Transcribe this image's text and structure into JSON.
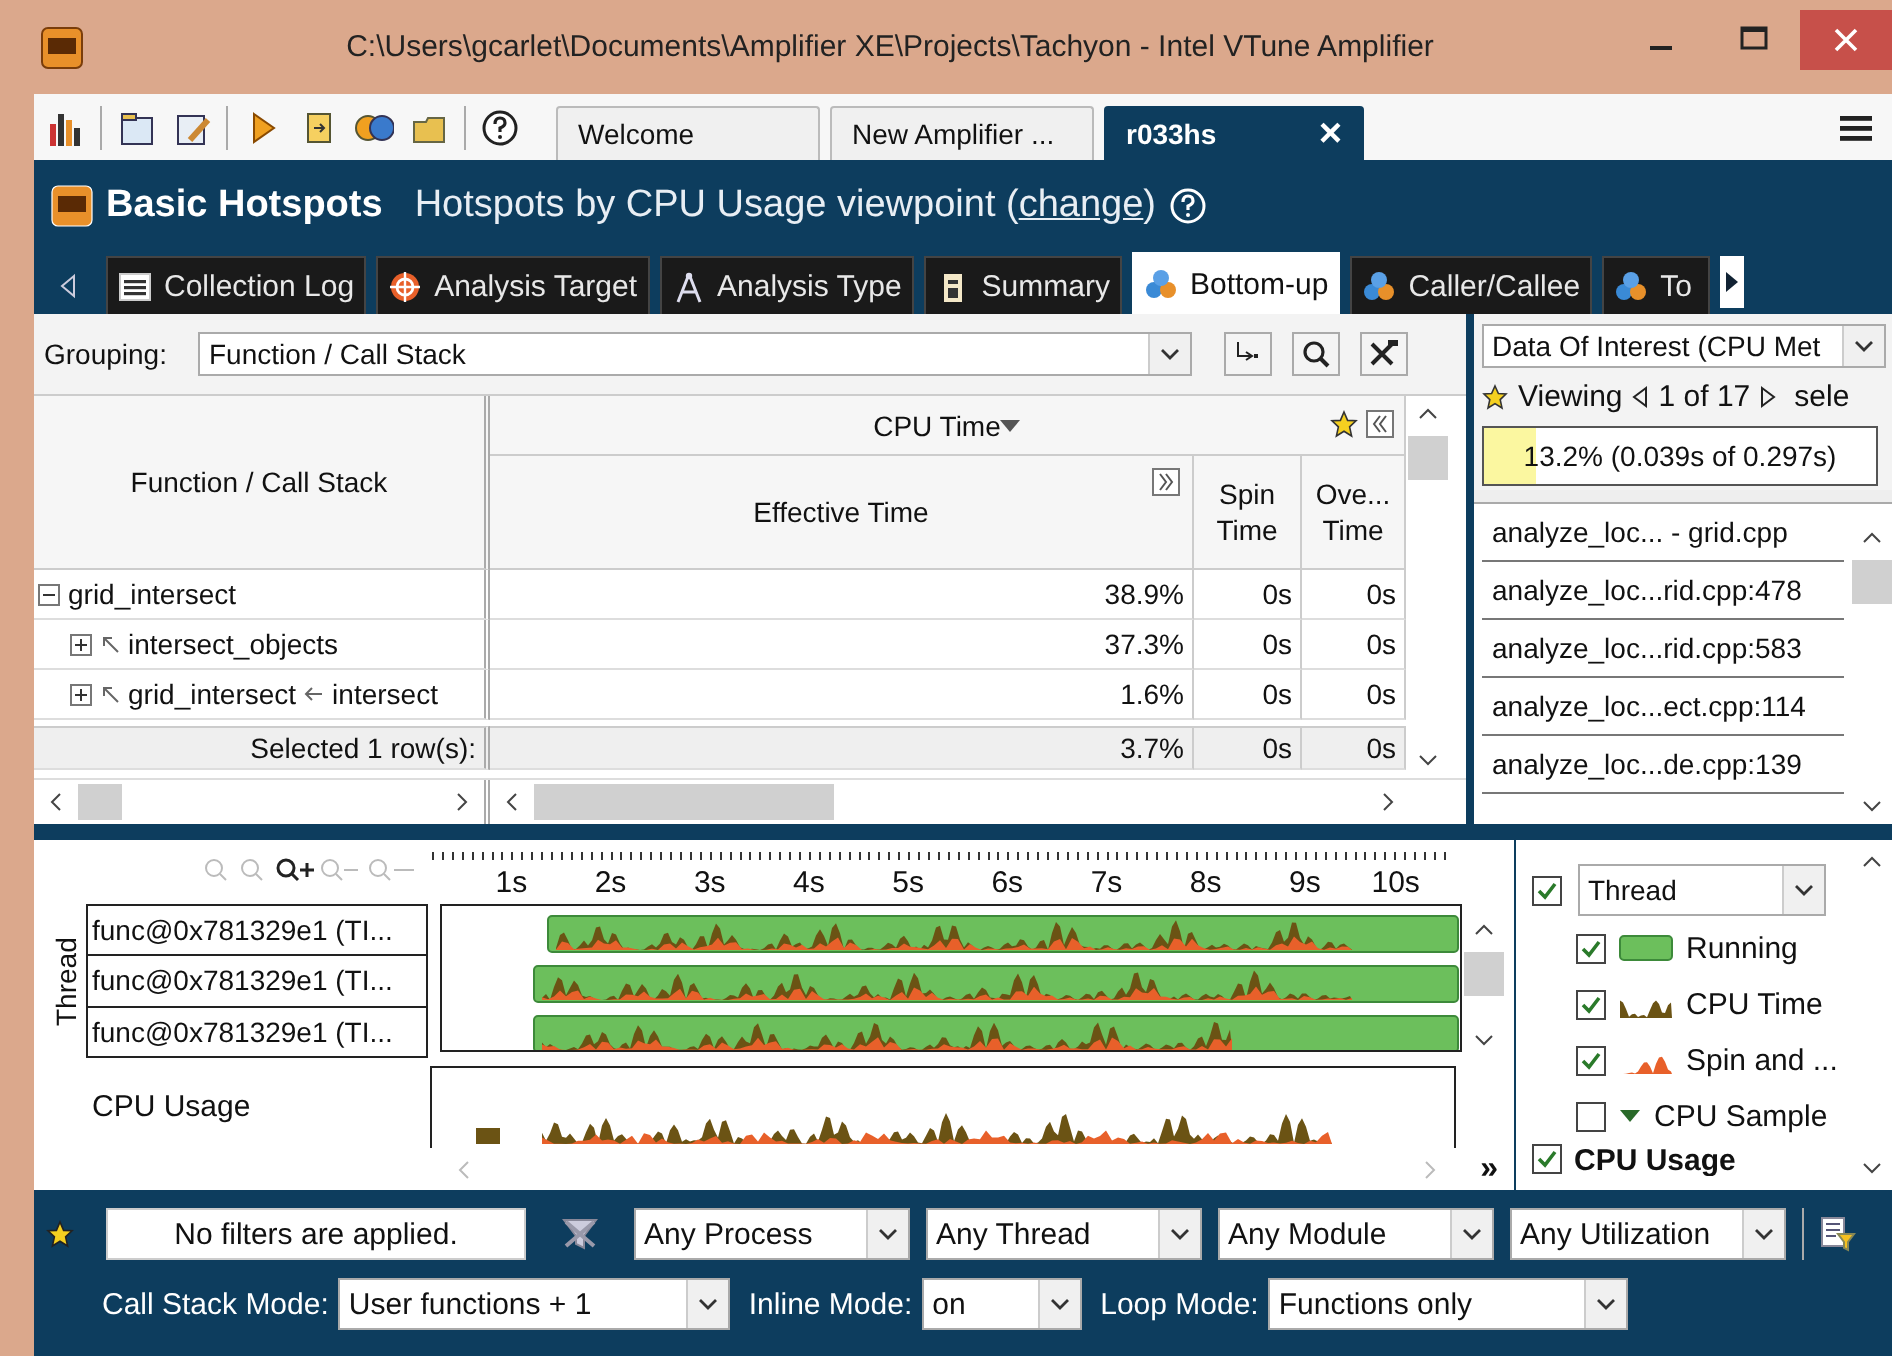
{
  "window": {
    "title": "C:\\Users\\gcarlet\\Documents\\Amplifier XE\\Projects\\Tachyon - Intel VTune Amplifier"
  },
  "doc_tabs": [
    {
      "label": "Welcome",
      "selected": false
    },
    {
      "label": "New Amplifier ...",
      "selected": false
    },
    {
      "label": "r033hs",
      "selected": true,
      "close": "×"
    }
  ],
  "header": {
    "title": "Basic Hotspots",
    "subtitle_before": "Hotspots by CPU Usage viewpoint (",
    "link": "change",
    "subtitle_after": ")"
  },
  "view_tabs": [
    {
      "label": "Collection Log",
      "kind": "log",
      "selected": false
    },
    {
      "label": "Analysis Target",
      "kind": "target",
      "selected": false
    },
    {
      "label": "Analysis Type",
      "kind": "type",
      "selected": false
    },
    {
      "label": "Summary",
      "kind": "summary",
      "selected": false
    },
    {
      "label": "Bottom-up",
      "kind": "balls",
      "selected": true
    },
    {
      "label": "Caller/Callee",
      "kind": "balls",
      "selected": false
    },
    {
      "label": "To",
      "kind": "balls",
      "selected": false
    }
  ],
  "grouping": {
    "label": "Grouping:",
    "value": "Function / Call Stack"
  },
  "table": {
    "group_header": "CPU Time",
    "columns": [
      "Function / Call Stack",
      "Effective Time",
      "Spin Time",
      "Ove... Time"
    ],
    "rows": [
      {
        "name": "grid_intersect",
        "effective": "38.9%",
        "spin": "0s",
        "overhead": "0s",
        "expanded": true,
        "children": [
          {
            "name": "intersect_objects",
            "effective": "37.3%",
            "spin": "0s",
            "overhead": "0s",
            "expanded": false
          },
          {
            "name": "grid_intersect",
            "caller": "intersect",
            "effective": "1.6%",
            "spin": "0s",
            "overhead": "0s",
            "expanded": false
          }
        ]
      }
    ],
    "summary": {
      "label": "Selected 1 row(s):",
      "effective": "3.7%",
      "spin": "0s",
      "overhead": "0s"
    }
  },
  "side_panel": {
    "dropdown": "Data Of Interest (CPU Met",
    "viewing": "Viewing",
    "position": "1 of 17",
    "after": "sele",
    "meter": {
      "level": 0.132,
      "reading": "13.2% (0.039s of 0.297s)"
    },
    "stack": [
      "analyze_loc... - grid.cpp",
      "analyze_loc...rid.cpp:478",
      "analyze_loc...rid.cpp:583",
      "analyze_loc...ect.cpp:114",
      "analyze_loc...de.cpp:139"
    ]
  },
  "timeline": {
    "ticks": [
      "1s",
      "2s",
      "3s",
      "4s",
      "5s",
      "6s",
      "7s",
      "8s",
      "9s",
      "10s"
    ],
    "axis_label": "Thread",
    "threads": [
      "func@0x781329e1 (TI...",
      "func@0x781329e1 (TI...",
      "func@0x781329e1 (TI..."
    ],
    "cpu_label": "CPU Usage",
    "more": "»",
    "legend_group": {
      "label": "Thread",
      "checked": true
    },
    "legend": [
      {
        "label": "Running",
        "kind": "bar",
        "checked": true
      },
      {
        "label": "CPU Time",
        "kind": "spikes",
        "checked": true
      },
      {
        "label": "Spin and ...",
        "kind": "spin",
        "checked": true
      },
      {
        "label": "CPU Sample",
        "kind": "marker",
        "checked": false
      }
    ],
    "legend_next": {
      "label": "CPU Usage",
      "checked": true
    }
  },
  "filters": {
    "status": "No filters are applied.",
    "dropdowns": [
      "Any Process",
      "Any Thread",
      "Any Module",
      "Any Utilization"
    ],
    "modes": [
      {
        "label": "Call Stack Mode:",
        "value": "User functions + 1"
      },
      {
        "label": "Inline Mode:",
        "value": "on"
      },
      {
        "label": "Loop Mode:",
        "value": "Functions only"
      }
    ]
  }
}
